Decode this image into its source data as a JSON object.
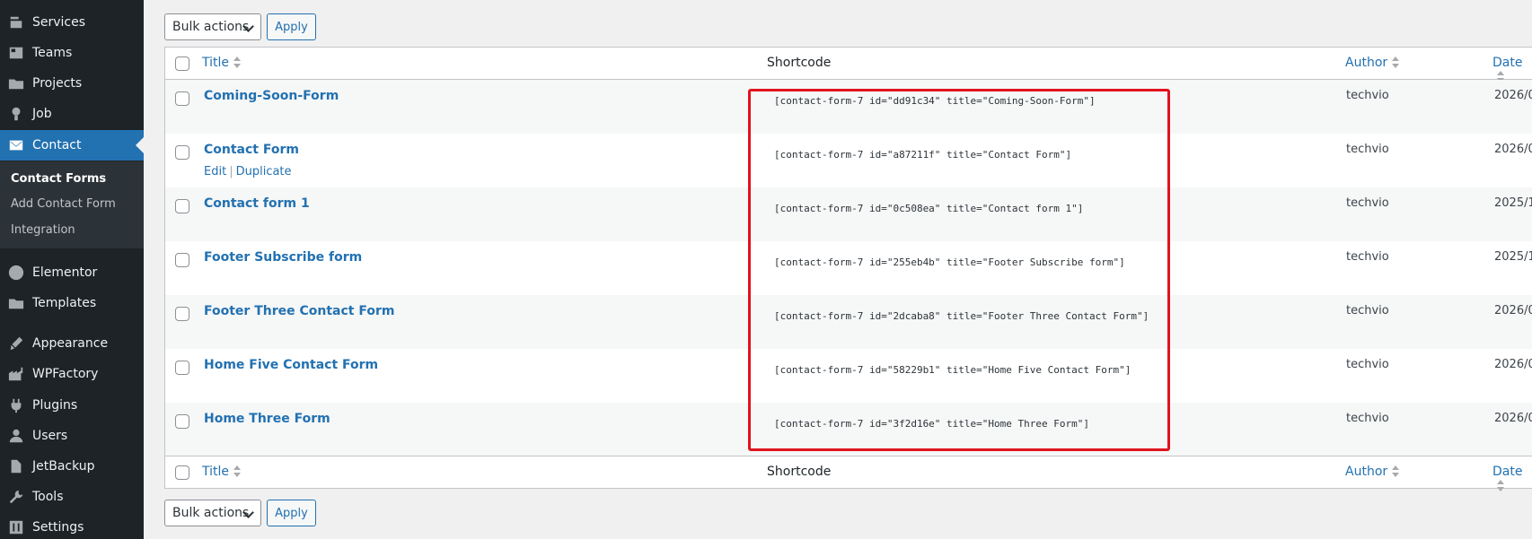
{
  "sidebar": {
    "menu": [
      {
        "label": "Services",
        "icon": "services-icon"
      },
      {
        "label": "Teams",
        "icon": "teams-icon"
      },
      {
        "label": "Projects",
        "icon": "projects-icon"
      },
      {
        "label": "Job",
        "icon": "job-icon"
      },
      {
        "label": "Contact",
        "icon": "mail-icon"
      },
      {
        "label": "Elementor",
        "icon": "elementor-icon"
      },
      {
        "label": "Templates",
        "icon": "templates-icon"
      },
      {
        "label": "Appearance",
        "icon": "appearance-icon"
      },
      {
        "label": "WPFactory",
        "icon": "wpfactory-icon"
      },
      {
        "label": "Plugins",
        "icon": "plugins-icon"
      },
      {
        "label": "Users",
        "icon": "users-icon"
      },
      {
        "label": "JetBackup",
        "icon": "jetbackup-icon"
      },
      {
        "label": "Tools",
        "icon": "tools-icon"
      },
      {
        "label": "Settings",
        "icon": "settings-icon"
      }
    ],
    "submenu": [
      "Contact Forms",
      "Add Contact Form",
      "Integration"
    ]
  },
  "toolbar": {
    "bulk_actions": "Bulk actions",
    "apply": "Apply"
  },
  "table": {
    "columns": {
      "title": "Title",
      "shortcode": "Shortcode",
      "author": "Author",
      "date": "Date"
    },
    "rows": [
      {
        "title": "Coming-Soon-Form",
        "shortcode": "[contact-form-7 id=\"dd91c34\" title=\"Coming-Soon-Form\"]",
        "author": "techvio",
        "date": "2026/0"
      },
      {
        "title": "Contact Form",
        "shortcode": "[contact-form-7 id=\"a87211f\" title=\"Contact Form\"]",
        "author": "techvio",
        "date": "2026/0",
        "actions": {
          "edit": "Edit",
          "sep": "|",
          "duplicate": "Duplicate"
        }
      },
      {
        "title": "Contact form 1",
        "shortcode": "[contact-form-7 id=\"0c508ea\" title=\"Contact form 1\"]",
        "author": "techvio",
        "date": "2025/1"
      },
      {
        "title": "Footer Subscribe form",
        "shortcode": "[contact-form-7 id=\"255eb4b\" title=\"Footer Subscribe form\"]",
        "author": "techvio",
        "date": "2025/1"
      },
      {
        "title": "Footer Three Contact Form",
        "shortcode": "[contact-form-7 id=\"2dcaba8\" title=\"Footer Three Contact Form\"]",
        "author": "techvio",
        "date": "2026/0"
      },
      {
        "title": "Home Five Contact Form",
        "shortcode": "[contact-form-7 id=\"58229b1\" title=\"Home Five Contact Form\"]",
        "author": "techvio",
        "date": "2026/0"
      },
      {
        "title": "Home Three Form",
        "shortcode": "[contact-form-7 id=\"3f2d16e\" title=\"Home Three Form\"]",
        "author": "techvio",
        "date": "2026/0"
      }
    ]
  },
  "colors": {
    "sidebar_bg": "#1d2327",
    "accent": "#2271b1",
    "highlight": "#e0141e"
  }
}
